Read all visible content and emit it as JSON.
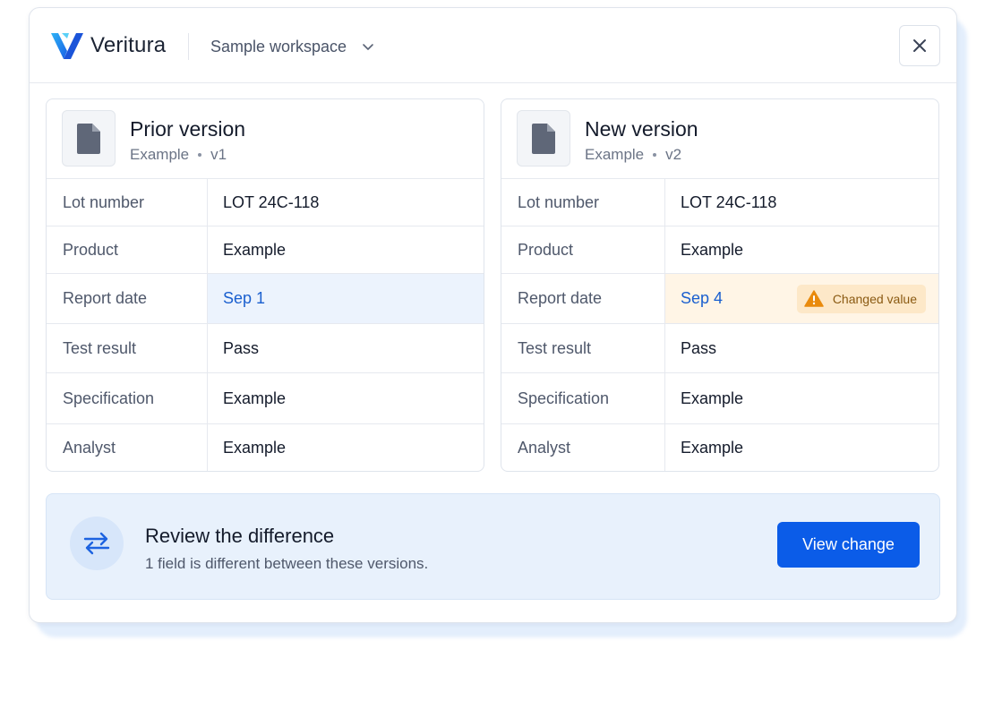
{
  "header": {
    "brand": "Veritura",
    "workspace": "Sample workspace",
    "close_icon": "close-icon",
    "dropdown_icon": "chevron-down-icon"
  },
  "colors": {
    "accent": "#0b5ce8",
    "changed_badge_bg": "#fde8c8",
    "warning": "#e98a0c",
    "highlight_blue": "#ecf3fd",
    "highlight_orange": "#fff5e6"
  },
  "prior": {
    "title": "Prior version",
    "subtitle_name": "Example",
    "subtitle_version": "v1",
    "rows": [
      {
        "label": "Lot number",
        "value": "LOT 24C-118"
      },
      {
        "label": "Product",
        "value": "Example"
      },
      {
        "label": "Report date",
        "value": "Sep 1"
      },
      {
        "label": "Test result",
        "value": "Pass"
      },
      {
        "label": "Specification",
        "value": "Example"
      },
      {
        "label": "Analyst",
        "value": "Example"
      }
    ]
  },
  "new": {
    "title": "New version",
    "subtitle_name": "Example",
    "subtitle_version": "v2",
    "rows": [
      {
        "label": "Lot number",
        "value": "LOT 24C-118"
      },
      {
        "label": "Product",
        "value": "Example"
      },
      {
        "label": "Report date",
        "value": "Sep 4"
      },
      {
        "label": "Test result",
        "value": "Pass"
      },
      {
        "label": "Specification",
        "value": "Example"
      },
      {
        "label": "Analyst",
        "value": "Example"
      }
    ],
    "changed_badge": "Changed value"
  },
  "review": {
    "title": "Review the difference",
    "text": "1 field is different between these versions.",
    "button": "View change",
    "icon": "swap-arrows-icon"
  }
}
